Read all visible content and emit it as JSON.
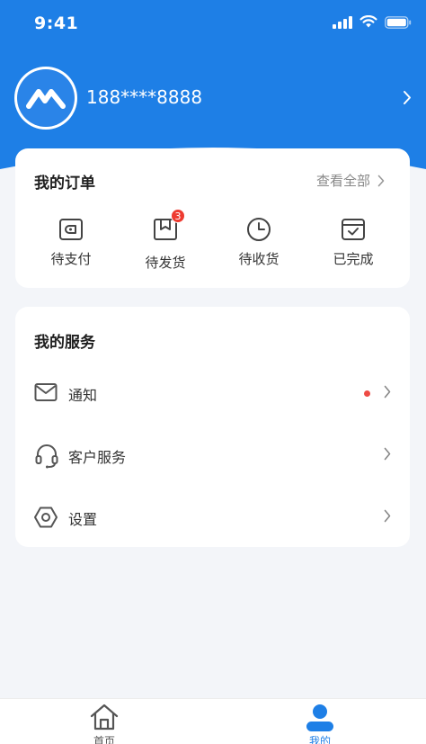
{
  "status_bar": {
    "time": "9:41"
  },
  "profile": {
    "phone": "188****8888"
  },
  "orders": {
    "title": "我的订单",
    "view_all": "查看全部",
    "items": [
      {
        "label": "待支付",
        "icon": "wallet-icon"
      },
      {
        "label": "待发货",
        "icon": "package-icon",
        "badge": "3"
      },
      {
        "label": "待收货",
        "icon": "clock-icon"
      },
      {
        "label": "已完成",
        "icon": "calendar-check-icon"
      }
    ]
  },
  "services": {
    "title": "我的服务",
    "items": [
      {
        "label": "通知",
        "icon": "mail-icon",
        "has_dot": true
      },
      {
        "label": "客户服务",
        "icon": "headset-icon"
      },
      {
        "label": "设置",
        "icon": "settings-hex-icon"
      }
    ]
  },
  "tabbar": {
    "items": [
      {
        "label": "首页",
        "icon": "home-icon",
        "active": false
      },
      {
        "label": "我的",
        "icon": "user-icon",
        "active": true
      }
    ]
  },
  "colors": {
    "primary": "#1e7fe6",
    "badge": "#ee3b30",
    "inactive": "#555555"
  }
}
